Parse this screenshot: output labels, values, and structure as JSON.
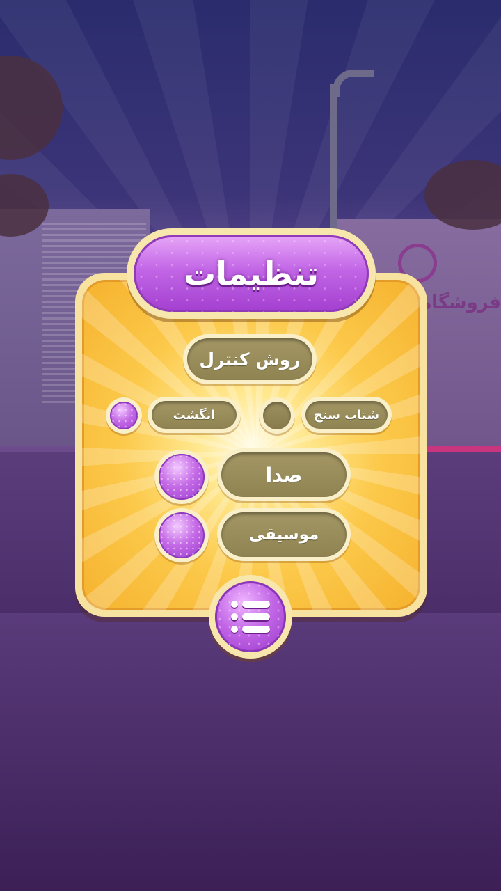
{
  "background": {
    "shop_sign": "فروشگاه"
  },
  "settings": {
    "title": "تنظیمات",
    "control_section_label": "روش کنترل",
    "control_options": [
      {
        "label": "شتاب سنج",
        "selected": false
      },
      {
        "label": "انگشت",
        "selected": true
      }
    ],
    "sound": {
      "label": "صدا",
      "enabled": true
    },
    "music": {
      "label": "موسیقی",
      "enabled": true
    }
  },
  "colors": {
    "accent_purple": "#b04fdb",
    "panel_orange": "#f5b22e",
    "pill_olive": "#978a58"
  },
  "icons": {
    "menu_button": "list-menu-icon"
  }
}
